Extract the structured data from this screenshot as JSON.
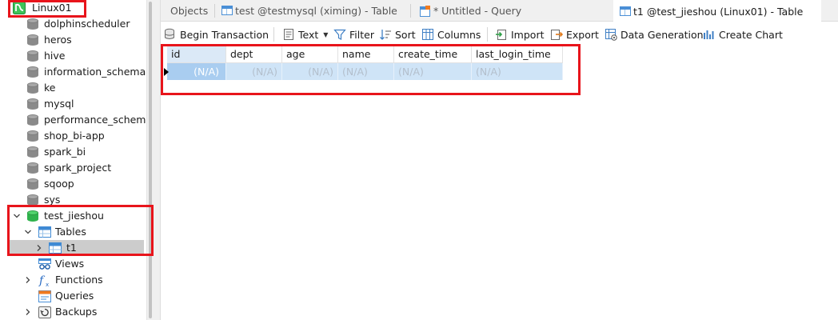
{
  "sidebar": {
    "connection": "Linux01",
    "databases": [
      "dolphinscheduler",
      "heros",
      "hive",
      "information_schema",
      "ke",
      "mysql",
      "performance_schema",
      "shop_bi-app",
      "spark_bi",
      "spark_project",
      "sqoop",
      "sys"
    ],
    "open_db": "test_jieshou",
    "tables_label": "Tables",
    "table_item": "t1",
    "views_label": "Views",
    "functions_label": "Functions",
    "queries_label": "Queries",
    "backups_label": "Backups"
  },
  "tabs": {
    "objects": "Objects",
    "tab1": "test @testmysql (ximing) - Table",
    "tab2": "* Untitled - Query",
    "tab3": "t1 @test_jieshou (Linux01) - Table"
  },
  "toolbar": {
    "begin_transaction": "Begin Transaction",
    "text": "Text",
    "filter": "Filter",
    "sort": "Sort",
    "columns": "Columns",
    "import": "Import",
    "export": "Export",
    "data_generation": "Data Generation",
    "create_chart": "Create Chart"
  },
  "grid": {
    "columns": [
      "id",
      "dept",
      "age",
      "name",
      "create_time",
      "last_login_time"
    ],
    "row": [
      "(N/A)",
      "(N/A)",
      "(N/A)",
      "(N/A)",
      "(N/A)",
      "(N/A)"
    ]
  },
  "colors": {
    "highlight": "#e8141b",
    "selection": "#cfe4f7",
    "db_green": "#2fb24c"
  }
}
